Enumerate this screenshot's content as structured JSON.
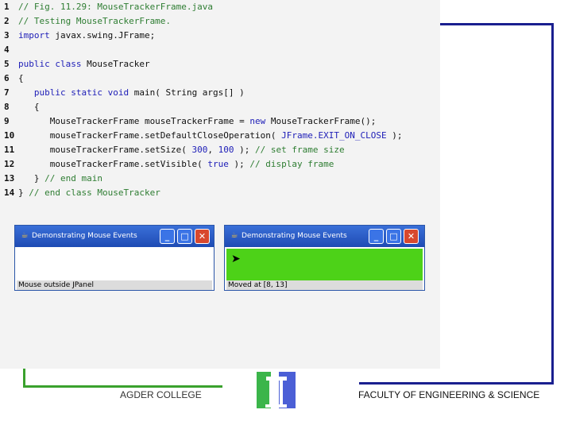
{
  "code": {
    "lines": [
      {
        "num": "1",
        "segments": [
          {
            "t": "// Fig. 11.29: MouseTrackerFrame.java",
            "c": "cm"
          }
        ]
      },
      {
        "num": "2",
        "segments": [
          {
            "t": "// Testing MouseTrackerFrame.",
            "c": "cm"
          }
        ]
      },
      {
        "num": "3",
        "segments": [
          {
            "t": "import",
            "c": "kw"
          },
          {
            "t": " javax.swing.JFrame;",
            "c": ""
          }
        ]
      },
      {
        "num": "4",
        "segments": []
      },
      {
        "num": "5",
        "segments": [
          {
            "t": "public class",
            "c": "kw"
          },
          {
            "t": " MouseTracker",
            "c": ""
          }
        ]
      },
      {
        "num": "6",
        "segments": [
          {
            "t": "{",
            "c": ""
          }
        ]
      },
      {
        "num": "7",
        "segments": [
          {
            "t": "   ",
            "c": ""
          },
          {
            "t": "public static void",
            "c": "kw"
          },
          {
            "t": " main( String args[] )",
            "c": ""
          }
        ]
      },
      {
        "num": "8",
        "segments": [
          {
            "t": "   {",
            "c": ""
          }
        ]
      },
      {
        "num": "9",
        "segments": [
          {
            "t": "      MouseTrackerFrame mouseTrackerFrame = ",
            "c": ""
          },
          {
            "t": "new",
            "c": "kw"
          },
          {
            "t": " MouseTrackerFrame();",
            "c": ""
          }
        ]
      },
      {
        "num": "10",
        "segments": [
          {
            "t": "      mouseTrackerFrame.setDefaultCloseOperation( ",
            "c": ""
          },
          {
            "t": "JFrame.EXIT_ON_CLOSE",
            "c": "const"
          },
          {
            "t": " );",
            "c": ""
          }
        ]
      },
      {
        "num": "11",
        "segments": [
          {
            "t": "      mouseTrackerFrame.setSize( ",
            "c": ""
          },
          {
            "t": "300",
            "c": "lit"
          },
          {
            "t": ", ",
            "c": ""
          },
          {
            "t": "100",
            "c": "lit"
          },
          {
            "t": " ); ",
            "c": ""
          },
          {
            "t": "// set frame size",
            "c": "cm"
          }
        ]
      },
      {
        "num": "12",
        "segments": [
          {
            "t": "      mouseTrackerFrame.setVisible( ",
            "c": ""
          },
          {
            "t": "true",
            "c": "kw"
          },
          {
            "t": " ); ",
            "c": ""
          },
          {
            "t": "// display frame",
            "c": "cm"
          }
        ]
      },
      {
        "num": "13",
        "segments": [
          {
            "t": "   } ",
            "c": ""
          },
          {
            "t": "// end main",
            "c": "cm"
          }
        ]
      },
      {
        "num": "14",
        "segments": [
          {
            "t": "} ",
            "c": ""
          },
          {
            "t": "// end class MouseTracker",
            "c": "cm"
          }
        ]
      }
    ]
  },
  "window1": {
    "title": "Demonstrating Mouse Events",
    "status": "Mouse outside JPanel",
    "minimize": "_",
    "maximize": "□",
    "close": "✕"
  },
  "window2": {
    "title": "Demonstrating Mouse Events",
    "status": "Moved at [8, 13]",
    "minimize": "_",
    "maximize": "□",
    "close": "✕",
    "panel_color": "#4dd218"
  },
  "footer": {
    "left": "AGDER COLLEGE",
    "right": "FACULTY OF ENGINEERING & SCIENCE"
  },
  "colors": {
    "frame_blue": "#1a1f8f",
    "frame_green": "#3aa12d"
  }
}
